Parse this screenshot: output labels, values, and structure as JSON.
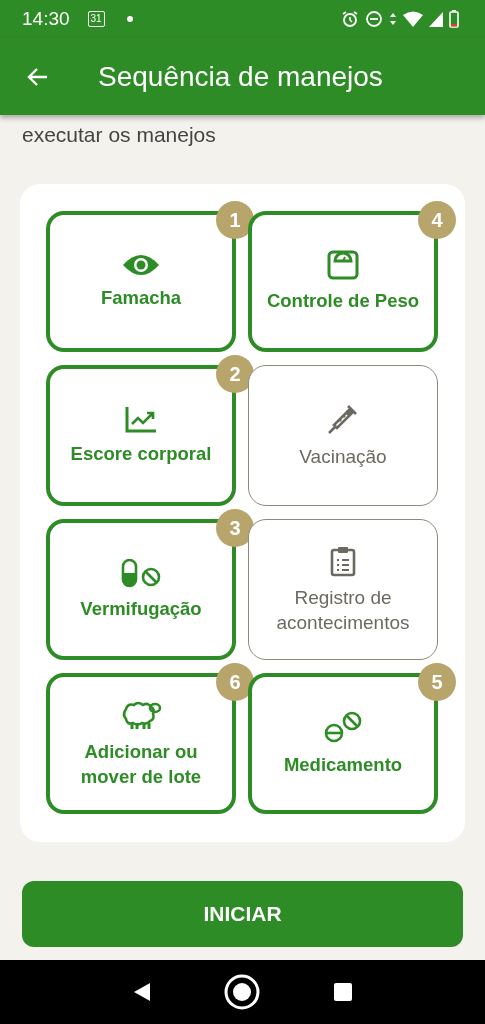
{
  "status_bar": {
    "time": "14:30",
    "calendar": "31"
  },
  "app_bar": {
    "title": "Sequência de manejos"
  },
  "intro": "executar os manejos",
  "tiles": [
    {
      "label": "Famacha",
      "selected": true,
      "order": "1"
    },
    {
      "label": "Controle de Peso",
      "selected": true,
      "order": "4"
    },
    {
      "label": "Escore corporal",
      "selected": true,
      "order": "2"
    },
    {
      "label": "Vacinação",
      "selected": false
    },
    {
      "label": "Vermifugação",
      "selected": true,
      "order": "3"
    },
    {
      "label": "Registro de acontecimentos",
      "selected": false
    },
    {
      "label": "Adicionar ou mover de lote",
      "selected": true,
      "order": "6"
    },
    {
      "label": "Medicamento",
      "selected": true,
      "order": "5"
    }
  ],
  "start_button": "INICIAR"
}
